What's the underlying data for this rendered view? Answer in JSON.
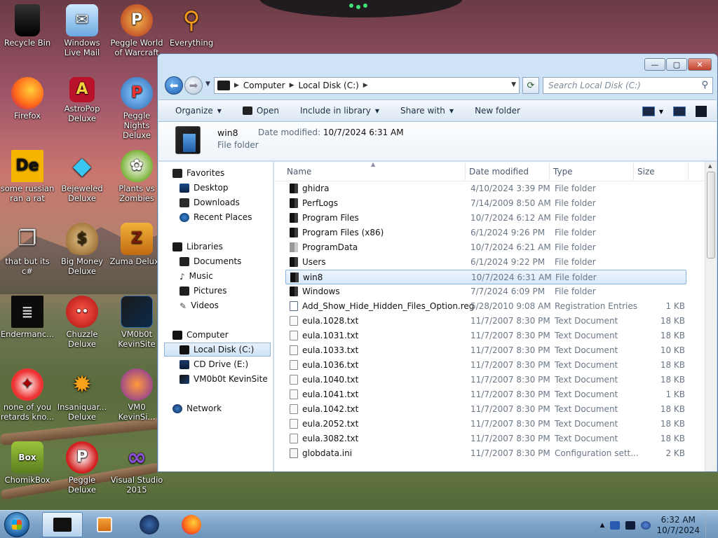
{
  "desktop_icons": [
    {
      "label": "Recycle Bin"
    },
    {
      "label": "Windows Live Mail"
    },
    {
      "label": "Peggle World of Warcraft"
    },
    {
      "label": "Everything"
    },
    {
      "label": "Firefox"
    },
    {
      "label": "AstroPop Deluxe"
    },
    {
      "label": "Peggle Nights Deluxe"
    },
    {
      "label": "some russian ran a rat"
    },
    {
      "label": "Bejeweled Deluxe"
    },
    {
      "label": "Plants vs Zombies"
    },
    {
      "label": "that but its c#"
    },
    {
      "label": "Big Money Deluxe"
    },
    {
      "label": "Zuma Deluxe"
    },
    {
      "label": "Endermanc..."
    },
    {
      "label": "Chuzzle Deluxe"
    },
    {
      "label": "VM0b0t KevinSite"
    },
    {
      "label": "none of you retards kno..."
    },
    {
      "label": "Insaniquar... Deluxe"
    },
    {
      "label": "VM0 KevinSi..."
    },
    {
      "label": "ChomikBox"
    },
    {
      "label": "Peggle Deluxe"
    },
    {
      "label": "Visual Studio 2015"
    }
  ],
  "window": {
    "controls": {
      "minimize": "—",
      "maximize": "▢",
      "close": "✕"
    },
    "breadcrumb": [
      "Computer",
      "Local Disk (C:)"
    ],
    "search_placeholder": "Search Local Disk (C:)",
    "toolbar": {
      "organize": "Organize",
      "open": "Open",
      "include_in_library": "Include in library",
      "share_with": "Share with",
      "new_folder": "New folder"
    },
    "details": {
      "name": "win8",
      "date_label": "Date modified:",
      "date_value": "10/7/2024 6:31 AM",
      "type": "File folder"
    },
    "nav": {
      "favorites": "Favorites",
      "desktop": "Desktop",
      "downloads": "Downloads",
      "recent_places": "Recent Places",
      "libraries": "Libraries",
      "documents": "Documents",
      "music": "Music",
      "pictures": "Pictures",
      "videos": "Videos",
      "computer": "Computer",
      "local_disk": "Local Disk (C:)",
      "cd_drive": "CD Drive (E:)",
      "vm_drive": "VM0b0t KevinSite",
      "network": "Network"
    },
    "columns": {
      "name": "Name",
      "date": "Date modified",
      "type": "Type",
      "size": "Size"
    },
    "files": [
      {
        "name": "ghidra",
        "date": "4/10/2024 3:39 PM",
        "type": "File folder",
        "size": ""
      },
      {
        "name": "PerfLogs",
        "date": "7/14/2009 8:50 AM",
        "type": "File folder",
        "size": ""
      },
      {
        "name": "Program Files",
        "date": "10/7/2024 6:12 AM",
        "type": "File folder",
        "size": ""
      },
      {
        "name": "Program Files (x86)",
        "date": "6/1/2024 9:26 PM",
        "type": "File folder",
        "size": ""
      },
      {
        "name": "ProgramData",
        "date": "10/7/2024 6:21 AM",
        "type": "File folder",
        "size": ""
      },
      {
        "name": "Users",
        "date": "6/1/2024 9:22 PM",
        "type": "File folder",
        "size": ""
      },
      {
        "name": "win8",
        "date": "10/7/2024 6:31 AM",
        "type": "File folder",
        "size": ""
      },
      {
        "name": "Windows",
        "date": "7/7/2024 6:09 PM",
        "type": "File folder",
        "size": ""
      },
      {
        "name": "Add_Show_Hide_Hidden_Files_Option.reg",
        "date": "5/28/2010 9:08 AM",
        "type": "Registration Entries",
        "size": "1 KB"
      },
      {
        "name": "eula.1028.txt",
        "date": "11/7/2007 8:30 PM",
        "type": "Text Document",
        "size": "18 KB"
      },
      {
        "name": "eula.1031.txt",
        "date": "11/7/2007 8:30 PM",
        "type": "Text Document",
        "size": "18 KB"
      },
      {
        "name": "eula.1033.txt",
        "date": "11/7/2007 8:30 PM",
        "type": "Text Document",
        "size": "10 KB"
      },
      {
        "name": "eula.1036.txt",
        "date": "11/7/2007 8:30 PM",
        "type": "Text Document",
        "size": "18 KB"
      },
      {
        "name": "eula.1040.txt",
        "date": "11/7/2007 8:30 PM",
        "type": "Text Document",
        "size": "18 KB"
      },
      {
        "name": "eula.1041.txt",
        "date": "11/7/2007 8:30 PM",
        "type": "Text Document",
        "size": "1 KB"
      },
      {
        "name": "eula.1042.txt",
        "date": "11/7/2007 8:30 PM",
        "type": "Text Document",
        "size": "18 KB"
      },
      {
        "name": "eula.2052.txt",
        "date": "11/7/2007 8:30 PM",
        "type": "Text Document",
        "size": "18 KB"
      },
      {
        "name": "eula.3082.txt",
        "date": "11/7/2007 8:30 PM",
        "type": "Text Document",
        "size": "18 KB"
      },
      {
        "name": "globdata.ini",
        "date": "11/7/2007 8:30 PM",
        "type": "Configuration sett...",
        "size": "2 KB"
      }
    ]
  },
  "taskbar": {
    "time": "6:32 AM",
    "date": "10/7/2024"
  },
  "colors": {
    "accent": "#3a78c3",
    "selection": "#cfe2f5"
  }
}
